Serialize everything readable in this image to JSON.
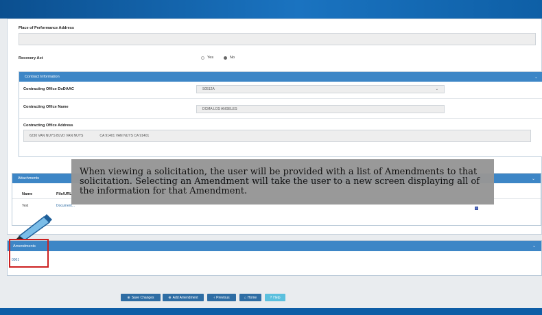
{
  "place_of_performance": {
    "label": "Place of Performance Address",
    "value": ""
  },
  "recovery_act": {
    "label": "Recovery Act",
    "options": [
      "Yes",
      "No"
    ],
    "selected": "No"
  },
  "contract_information": {
    "title": "Contract Information",
    "dodaac_label": "Contracting Office DoDAAC",
    "dodaac_value": "S0512A",
    "name_label": "Contracting Office Name",
    "name_value": "DCMA LOS ANGELES",
    "address_label": "Contracting Office Address",
    "address_line1": "6230 VAN NUYS BLVD VAN NUYS",
    "address_line2": "CA 91401 VAN NUYS  CA  91401"
  },
  "attachments": {
    "title": "Attachments",
    "col_name": "Name",
    "col_file": "File/URL",
    "row_name": "Test",
    "row_file": "Document..."
  },
  "tooltip": {
    "text": "When viewing a solicitation, the user will be provided with a list of Amendments to that solicitation. Selecting an Amendment will take the user to a new screen displaying all of the information for that Amendment."
  },
  "amendments": {
    "title": "Amendments",
    "items": [
      "0001"
    ]
  },
  "buttons": {
    "save": "Save Changes",
    "add_amendment": "Add Amendment",
    "previous": "Previous",
    "home": "Home",
    "help": "Help"
  },
  "colors": {
    "accent": "#3d86c6",
    "highlight": "#cc1f1f",
    "tooltip_bg": "#969696"
  }
}
